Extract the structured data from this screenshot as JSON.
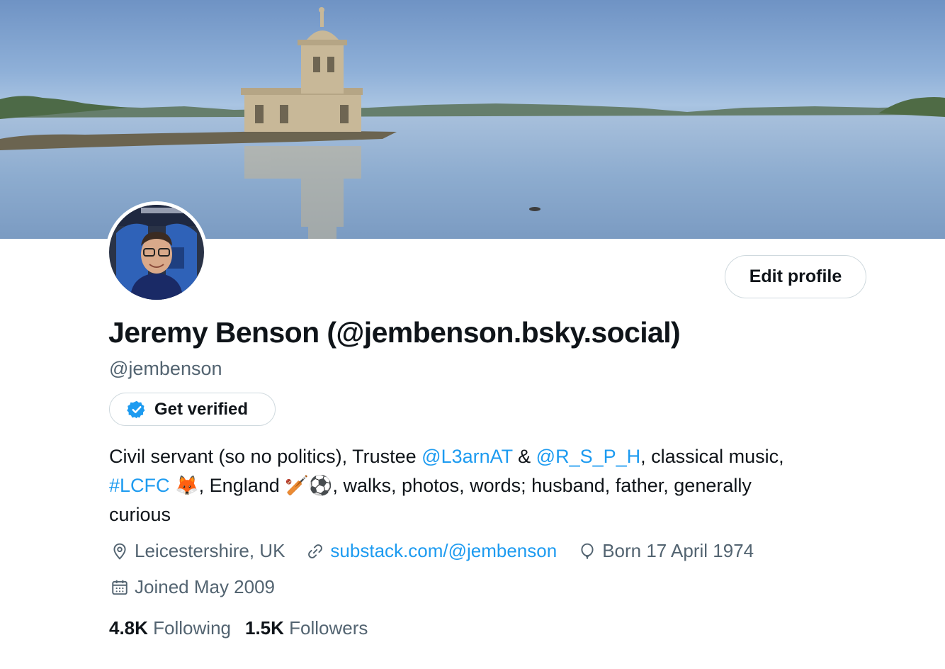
{
  "profile": {
    "display_name": "Jeremy Benson (@jembenson.bsky.social)",
    "handle": "@jembenson",
    "edit_profile_label": "Edit profile",
    "get_verified_label": "Get verified",
    "bio": {
      "part1": "Civil servant (so no politics), Trustee ",
      "mention1": "@L3arnAT",
      "part2": " & ",
      "mention2": "@R_S_P_H",
      "part3": ", classical music,",
      "hashtag": "#LCFC",
      "emoji_fox": "🦊",
      "part4": ", England ",
      "emoji_cricket": "🏏",
      "emoji_football": "⚽",
      "part5": ", walks, photos, words; husband, father, generally",
      "part6": "curious"
    },
    "location": "Leicestershire, UK",
    "website": "substack.com/@jembenson",
    "birthday": "Born 17 April 1974",
    "joined": "Joined May 2009",
    "following_count": "4.8K",
    "following_label": "Following",
    "followers_count": "1.5K",
    "followers_label": "Followers"
  },
  "icons": {
    "location": "location-pin-icon",
    "website": "link-icon",
    "birthday": "balloon-icon",
    "joined": "calendar-icon",
    "verified": "verified-badge-icon"
  },
  "colors": {
    "link": "#1d9bf0",
    "secondary_text": "#536471",
    "primary_text": "#0f1419",
    "border": "#cfd9de"
  }
}
